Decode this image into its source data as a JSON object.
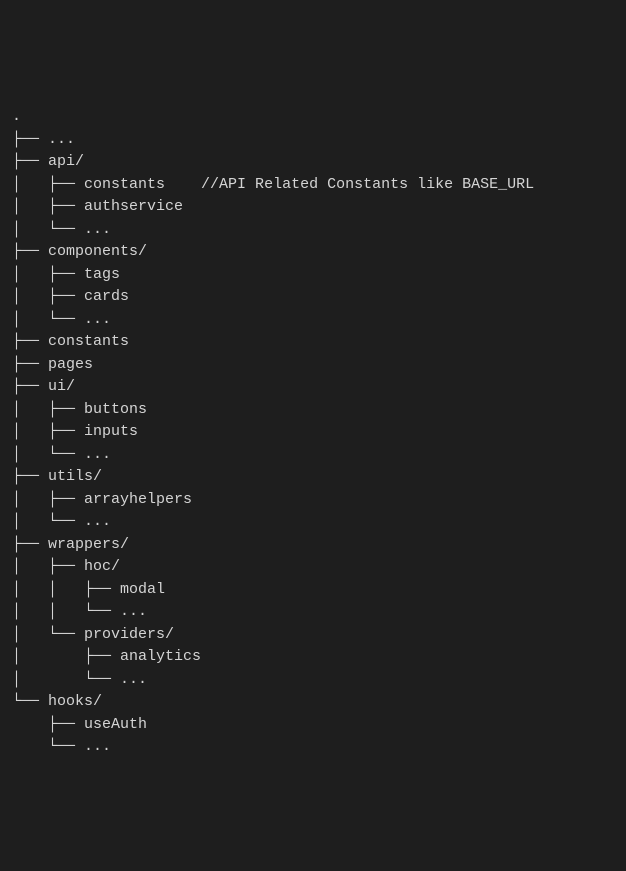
{
  "root": ".",
  "tree": [
    {
      "prefix": "├── ",
      "name": "...",
      "depth": 0,
      "pipes": ""
    },
    {
      "prefix": "├── ",
      "name": "api/",
      "depth": 0,
      "pipes": ""
    },
    {
      "prefix": "├── ",
      "name": "constants",
      "depth": 1,
      "pipes": "│   ",
      "comment": "    //API Related Constants like BASE_URL"
    },
    {
      "prefix": "├── ",
      "name": "authservice",
      "depth": 1,
      "pipes": "│   "
    },
    {
      "prefix": "└── ",
      "name": "...",
      "depth": 1,
      "pipes": "│   "
    },
    {
      "prefix": "├── ",
      "name": "components/",
      "depth": 0,
      "pipes": ""
    },
    {
      "prefix": "├── ",
      "name": "tags",
      "depth": 1,
      "pipes": "│   "
    },
    {
      "prefix": "├── ",
      "name": "cards",
      "depth": 1,
      "pipes": "│   "
    },
    {
      "prefix": "└── ",
      "name": "...",
      "depth": 1,
      "pipes": "│   "
    },
    {
      "prefix": "├── ",
      "name": "constants",
      "depth": 0,
      "pipes": ""
    },
    {
      "prefix": "├── ",
      "name": "pages",
      "depth": 0,
      "pipes": ""
    },
    {
      "prefix": "├── ",
      "name": "ui/",
      "depth": 0,
      "pipes": ""
    },
    {
      "prefix": "├── ",
      "name": "buttons",
      "depth": 1,
      "pipes": "│   "
    },
    {
      "prefix": "├── ",
      "name": "inputs",
      "depth": 1,
      "pipes": "│   "
    },
    {
      "prefix": "└── ",
      "name": "...",
      "depth": 1,
      "pipes": "│   "
    },
    {
      "prefix": "├── ",
      "name": "utils/",
      "depth": 0,
      "pipes": ""
    },
    {
      "prefix": "├── ",
      "name": "arrayhelpers",
      "depth": 1,
      "pipes": "│   "
    },
    {
      "prefix": "└── ",
      "name": "...",
      "depth": 1,
      "pipes": "│   "
    },
    {
      "prefix": "├── ",
      "name": "wrappers/",
      "depth": 0,
      "pipes": ""
    },
    {
      "prefix": "├── ",
      "name": "hoc/",
      "depth": 1,
      "pipes": "│   "
    },
    {
      "prefix": "├── ",
      "name": "modal",
      "depth": 2,
      "pipes": "│   │   "
    },
    {
      "prefix": "└── ",
      "name": "...",
      "depth": 2,
      "pipes": "│   │   "
    },
    {
      "prefix": "└── ",
      "name": "providers/",
      "depth": 1,
      "pipes": "│   "
    },
    {
      "prefix": "├── ",
      "name": "analytics",
      "depth": 2,
      "pipes": "│       "
    },
    {
      "prefix": "└── ",
      "name": "...",
      "depth": 2,
      "pipes": "│       "
    },
    {
      "prefix": "└── ",
      "name": "hooks/",
      "depth": 0,
      "pipes": ""
    },
    {
      "prefix": "├── ",
      "name": "useAuth",
      "depth": 1,
      "pipes": "    "
    },
    {
      "prefix": "└── ",
      "name": "...",
      "depth": 1,
      "pipes": "    "
    }
  ]
}
